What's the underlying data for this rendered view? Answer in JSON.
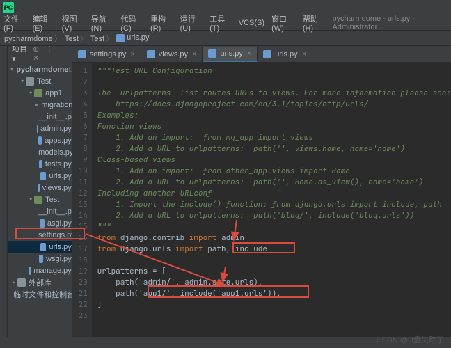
{
  "title": "pycharmdome - urls.py - Administrator",
  "logo": "PC",
  "menu": [
    "文件(F)",
    "编辑(E)",
    "视图(V)",
    "导航(N)",
    "代码(C)",
    "重构(R)",
    "运行(U)",
    "工具(T)",
    "VCS(S)",
    "窗口(W)",
    "帮助(H)"
  ],
  "breadcrumb": {
    "parts": [
      "pycharmdome",
      "Test",
      "Test"
    ],
    "file": "urls.py"
  },
  "project": {
    "title": "项目 ▾",
    "root": {
      "name": "pycharmdome",
      "path": "D:\\pycharmdome"
    },
    "tree": [
      {
        "d": 1,
        "t": "folder",
        "a": "▾",
        "n": "Test"
      },
      {
        "d": 2,
        "t": "pkg",
        "a": "▾",
        "n": "app1"
      },
      {
        "d": 3,
        "t": "pkg",
        "a": "▸",
        "n": "migrations"
      },
      {
        "d": 3,
        "t": "py",
        "a": "",
        "n": "__init__.py"
      },
      {
        "d": 3,
        "t": "py",
        "a": "",
        "n": "admin.py"
      },
      {
        "d": 3,
        "t": "py",
        "a": "",
        "n": "apps.py"
      },
      {
        "d": 3,
        "t": "py",
        "a": "",
        "n": "models.py"
      },
      {
        "d": 3,
        "t": "py",
        "a": "",
        "n": "tests.py"
      },
      {
        "d": 3,
        "t": "py",
        "a": "",
        "n": "urls.py"
      },
      {
        "d": 3,
        "t": "py",
        "a": "",
        "n": "views.py"
      },
      {
        "d": 2,
        "t": "pkg",
        "a": "▾",
        "n": "Test"
      },
      {
        "d": 3,
        "t": "py",
        "a": "",
        "n": "__init__.py"
      },
      {
        "d": 3,
        "t": "py",
        "a": "",
        "n": "asgi.py"
      },
      {
        "d": 3,
        "t": "py",
        "a": "",
        "n": "settings.py"
      },
      {
        "d": 3,
        "t": "py",
        "a": "",
        "n": "urls.py",
        "sel": true
      },
      {
        "d": 3,
        "t": "py",
        "a": "",
        "n": "wsgi.py"
      },
      {
        "d": 2,
        "t": "py",
        "a": "",
        "n": "manage.py"
      },
      {
        "d": 0,
        "t": "folder",
        "a": "▸",
        "n": "外部库"
      },
      {
        "d": 0,
        "t": "folder",
        "a": "",
        "n": "临时文件和控制台"
      }
    ]
  },
  "tabs": [
    {
      "n": "settings.py",
      "active": false
    },
    {
      "n": "views.py",
      "active": false
    },
    {
      "n": "urls.py",
      "active": true
    },
    {
      "n": "urls.py",
      "active": false
    }
  ],
  "code": {
    "lines": [
      "\"\"\"Test URL Configuration",
      "",
      "The `urlpatterns` list routes URLs to views. For more information please see:",
      "    https://docs.djangoproject.com/en/3.1/topics/http/urls/",
      "Examples:",
      "Function views",
      "    1. Add an import:  from my_app import views",
      "    2. Add a URL to urlpatterns:  path('', views.home, name='home')",
      "Class-based views",
      "    1. Add an import:  from other_app.views import Home",
      "    2. Add a URL to urlpatterns:  path('', Home.as_view(), name='home')",
      "Including another URLconf",
      "    1. Import the include() function: from django.urls import include, path",
      "    2. Add a URL to urlpatterns:  path('blog/', include('blog.urls'))",
      "\"\"\"",
      [
        "kw:from",
        " django.contrib ",
        "kw:import",
        " admin"
      ],
      [
        "kw:from",
        " django.urls ",
        "kw:import",
        " path, include"
      ],
      "",
      "urlpatterns = [",
      "    path('admin/', admin.site.urls),",
      "    path('app1/', include('app1.urls')),",
      "]",
      ""
    ]
  },
  "watermark": "CSDN @U盘失踪了"
}
